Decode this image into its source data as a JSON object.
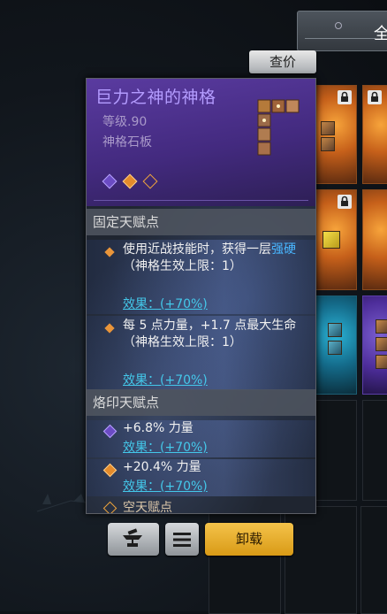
{
  "top_tab": {
    "label": "全"
  },
  "price_check": {
    "label": "查价"
  },
  "tooltip": {
    "title": "巨力之神的神格",
    "level": "等级.90",
    "type": "神格石板",
    "socket_gems": [
      "purple-diamond-icon",
      "orange-diamond-icon",
      "gold-outline-diamond-icon"
    ],
    "fixed_section": {
      "header": "固定天赋点",
      "rows": [
        {
          "prefix": "使用近战技能时，获得一层",
          "highlight": "强硬",
          "suffix": "（神格生效上限：1）",
          "effect": "效果：(+70%)"
        },
        {
          "prefix": "每 5 点力量，+1.7 点最大生命（神格生效上限：1）",
          "highlight": "",
          "suffix": "",
          "effect": "效果：(+70%)"
        }
      ]
    },
    "imprint_section": {
      "header": "烙印天赋点",
      "rows": [
        {
          "text": "+6.8% 力量",
          "effect": "效果：(+70%)",
          "gem": "purple-diamond-icon"
        },
        {
          "text": "+20.4% 力量",
          "effect": "效果：(+70%)",
          "gem": "orange-diamond-icon"
        }
      ],
      "cut_off_text": "空天赋点"
    }
  },
  "actions": {
    "equip_compare_icon": "anvil-icon",
    "more_icon": "menu-icon",
    "unequip_label": "卸载"
  },
  "colors": {
    "title": "#b49cff",
    "highlight": "#49b6ff",
    "effect": "#44c8ea",
    "gold_button": "#f0b630"
  }
}
